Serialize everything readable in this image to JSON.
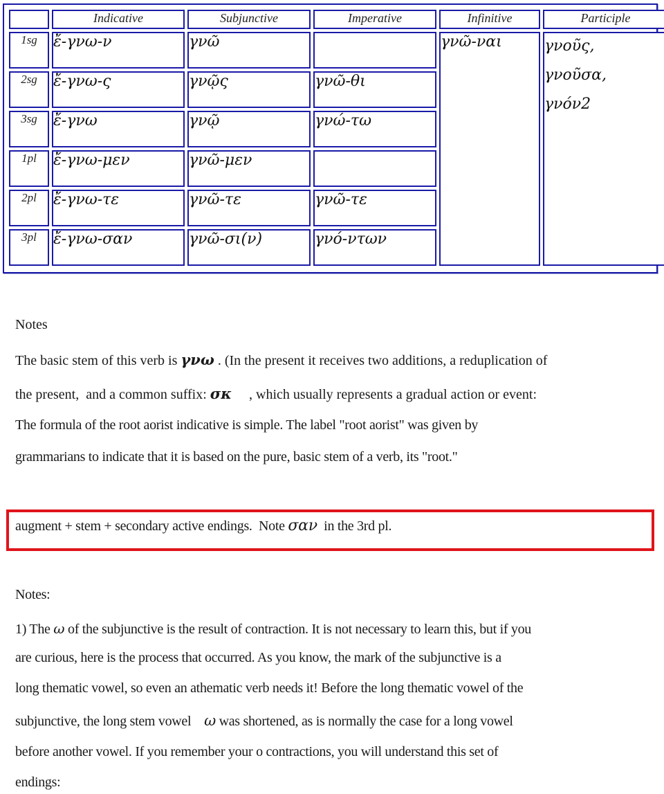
{
  "table": {
    "headers": [
      "",
      "Indicative",
      "Subjunctive",
      "Imperative",
      "Infinitive",
      "Participle"
    ],
    "rows": [
      {
        "person": "1sg",
        "indicative": "ἔ-γνω-ν",
        "subjunctive": "γνῶ",
        "imperative": ""
      },
      {
        "person": "2sg",
        "indicative": "ἔ-γνω-ς",
        "subjunctive": "γνῷς",
        "imperative": "γνῶ-θι"
      },
      {
        "person": "3sg",
        "indicative": "ἔ-γνω",
        "subjunctive": "γνῷ",
        "imperative": "γνώ-τω"
      },
      {
        "person": "1pl",
        "indicative": "ἔ-γνω-μεν",
        "subjunctive": "γνῶ-μεν",
        "imperative": ""
      },
      {
        "person": "2pl",
        "indicative": "ἔ-γνω-τε",
        "subjunctive": "γνῶ-τε",
        "imperative": "γνῶ-τε"
      },
      {
        "person": "3pl",
        "indicative": "ἔ-γνω-σαν",
        "subjunctive": "γνῶ-σι(ν)",
        "imperative": "γνό-ντων"
      }
    ],
    "infinitive": "γνῶ-ναι",
    "participle": [
      "γνοῦς,",
      "γνοῦσα,",
      "γνόν2"
    ]
  },
  "notes": {
    "heading": "Notes",
    "line1_a": "The basic stem of this verb is ",
    "line1_greek": "γνω",
    "line1_b": " .  (In the present it receives two additions, a reduplication of",
    "line2_a": "the present,  and a common suffix: ",
    "line2_greek": "σκ",
    "line2_b": "     , which usually represents a gradual action or event:",
    "line3": "The formula of the root aorist indicative is simple.  The label \"root aorist\" was given by",
    "line4": "grammarians to indicate that it is based on the pure, basic stem of a verb, its \"root.\""
  },
  "formula_box": {
    "text_a": "augment + stem + secondary active endings.  Note ",
    "greek": "σαν",
    "text_b": "  in the 3rd pl.",
    "border_color": "#e0141b"
  },
  "notes2": {
    "heading": "Notes:",
    "line1_a": "1) The ",
    "line1_greek": "ω",
    "line1_b": " of the subjunctive is the result of contraction.  It is not necessary to learn this, but if you",
    "line2": "are curious, here is the process that occurred.  As you know, the mark of the subjunctive is a",
    "line3": "long thematic vowel, so even an athematic verb needs it!   Before the long thematic vowel of the",
    "line4_a": "subjunctive, the long stem vowel    ",
    "line4_greek": "ω",
    "line4_b": " was shortened, as is normally the case for a long vowel",
    "line5": "before another vowel.  If you remember your o contractions, you will understand this set of",
    "line6": "endings:"
  },
  "colors": {
    "table_border": "#1a1aa8",
    "highlight_box": "#e0141b"
  }
}
